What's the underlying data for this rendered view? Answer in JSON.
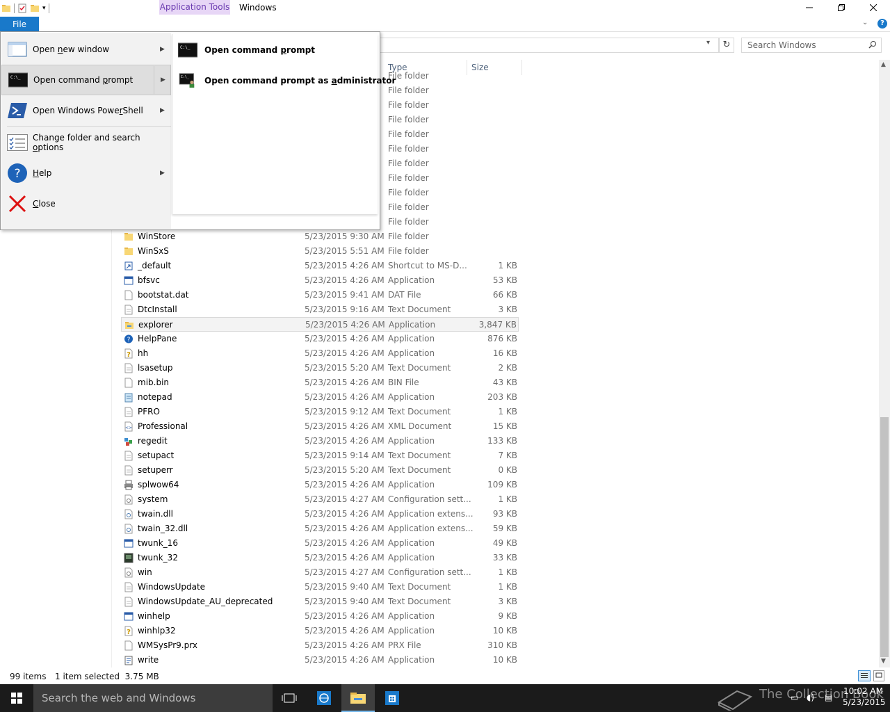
{
  "window": {
    "contextual_tab": "Application Tools",
    "title": "Windows"
  },
  "ribbon": {
    "file_tab": "File"
  },
  "search": {
    "placeholder": "Search Windows"
  },
  "columns": {
    "type": "Type",
    "size": "Size"
  },
  "files": [
    {
      "name": "",
      "date": "",
      "type": "File folder",
      "size": "",
      "icon": "folder-icon"
    },
    {
      "name": "",
      "date": "",
      "type": "File folder",
      "size": "",
      "icon": "folder-icon"
    },
    {
      "name": "",
      "date": "",
      "type": "File folder",
      "size": "",
      "icon": "folder-icon"
    },
    {
      "name": "",
      "date": "",
      "type": "File folder",
      "size": "",
      "icon": "folder-icon"
    },
    {
      "name": "",
      "date": "",
      "type": "File folder",
      "size": "",
      "icon": "folder-icon"
    },
    {
      "name": "",
      "date": "",
      "type": "File folder",
      "size": "",
      "icon": "folder-icon"
    },
    {
      "name": "",
      "date": "",
      "type": "File folder",
      "size": "",
      "icon": "folder-icon"
    },
    {
      "name": "",
      "date": "",
      "type": "File folder",
      "size": "",
      "icon": "folder-icon"
    },
    {
      "name": "",
      "date": "",
      "type": "File folder",
      "size": "",
      "icon": "folder-icon"
    },
    {
      "name": "",
      "date": "",
      "type": "File folder",
      "size": "",
      "icon": "folder-icon"
    },
    {
      "name": "",
      "date": "",
      "type": "File folder",
      "size": "",
      "icon": "folder-icon"
    },
    {
      "name": "WinStore",
      "date": "5/23/2015 9:30 AM",
      "type": "File folder",
      "size": "",
      "icon": "folder-icon"
    },
    {
      "name": "WinSxS",
      "date": "5/23/2015 5:51 AM",
      "type": "File folder",
      "size": "",
      "icon": "folder-icon"
    },
    {
      "name": "_default",
      "date": "5/23/2015 4:26 AM",
      "type": "Shortcut to MS-D...",
      "size": "1 KB",
      "icon": "shortcut-icon"
    },
    {
      "name": "bfsvc",
      "date": "5/23/2015 4:26 AM",
      "type": "Application",
      "size": "53 KB",
      "icon": "application-icon"
    },
    {
      "name": "bootstat.dat",
      "date": "5/23/2015 9:41 AM",
      "type": "DAT File",
      "size": "66 KB",
      "icon": "file-icon"
    },
    {
      "name": "DtcInstall",
      "date": "5/23/2015 9:16 AM",
      "type": "Text Document",
      "size": "3 KB",
      "icon": "text-file-icon"
    },
    {
      "name": "explorer",
      "date": "5/23/2015 4:26 AM",
      "type": "Application",
      "size": "3,847 KB",
      "icon": "explorer-icon",
      "selected": true
    },
    {
      "name": "HelpPane",
      "date": "5/23/2015 4:26 AM",
      "type": "Application",
      "size": "876 KB",
      "icon": "help-icon"
    },
    {
      "name": "hh",
      "date": "5/23/2015 4:26 AM",
      "type": "Application",
      "size": "16 KB",
      "icon": "help-file-icon"
    },
    {
      "name": "lsasetup",
      "date": "5/23/2015 5:20 AM",
      "type": "Text Document",
      "size": "2 KB",
      "icon": "text-file-icon"
    },
    {
      "name": "mib.bin",
      "date": "5/23/2015 4:26 AM",
      "type": "BIN File",
      "size": "43 KB",
      "icon": "file-icon"
    },
    {
      "name": "notepad",
      "date": "5/23/2015 4:26 AM",
      "type": "Application",
      "size": "203 KB",
      "icon": "notepad-icon"
    },
    {
      "name": "PFRO",
      "date": "5/23/2015 9:12 AM",
      "type": "Text Document",
      "size": "1 KB",
      "icon": "text-file-icon"
    },
    {
      "name": "Professional",
      "date": "5/23/2015 4:26 AM",
      "type": "XML Document",
      "size": "15 KB",
      "icon": "xml-file-icon"
    },
    {
      "name": "regedit",
      "date": "5/23/2015 4:26 AM",
      "type": "Application",
      "size": "133 KB",
      "icon": "regedit-icon"
    },
    {
      "name": "setupact",
      "date": "5/23/2015 9:14 AM",
      "type": "Text Document",
      "size": "7 KB",
      "icon": "text-file-icon"
    },
    {
      "name": "setuperr",
      "date": "5/23/2015 5:20 AM",
      "type": "Text Document",
      "size": "0 KB",
      "icon": "text-file-icon"
    },
    {
      "name": "splwow64",
      "date": "5/23/2015 4:26 AM",
      "type": "Application",
      "size": "109 KB",
      "icon": "printer-icon"
    },
    {
      "name": "system",
      "date": "5/23/2015 4:27 AM",
      "type": "Configuration sett...",
      "size": "1 KB",
      "icon": "config-file-icon"
    },
    {
      "name": "twain.dll",
      "date": "5/23/2015 4:26 AM",
      "type": "Application extens...",
      "size": "93 KB",
      "icon": "dll-icon"
    },
    {
      "name": "twain_32.dll",
      "date": "5/23/2015 4:26 AM",
      "type": "Application extens...",
      "size": "59 KB",
      "icon": "dll-icon"
    },
    {
      "name": "twunk_16",
      "date": "5/23/2015 4:26 AM",
      "type": "Application",
      "size": "49 KB",
      "icon": "application-icon"
    },
    {
      "name": "twunk_32",
      "date": "5/23/2015 4:26 AM",
      "type": "Application",
      "size": "33 KB",
      "icon": "scanner-icon"
    },
    {
      "name": "win",
      "date": "5/23/2015 4:27 AM",
      "type": "Configuration sett...",
      "size": "1 KB",
      "icon": "config-file-icon"
    },
    {
      "name": "WindowsUpdate",
      "date": "5/23/2015 9:40 AM",
      "type": "Text Document",
      "size": "1 KB",
      "icon": "text-file-icon"
    },
    {
      "name": "WindowsUpdate_AU_deprecated",
      "date": "5/23/2015 9:40 AM",
      "type": "Text Document",
      "size": "3 KB",
      "icon": "text-file-icon"
    },
    {
      "name": "winhelp",
      "date": "5/23/2015 4:26 AM",
      "type": "Application",
      "size": "9 KB",
      "icon": "application-icon"
    },
    {
      "name": "winhlp32",
      "date": "5/23/2015 4:26 AM",
      "type": "Application",
      "size": "10 KB",
      "icon": "help-file-icon"
    },
    {
      "name": "WMSysPr9.prx",
      "date": "5/23/2015 4:26 AM",
      "type": "PRX File",
      "size": "310 KB",
      "icon": "file-icon"
    },
    {
      "name": "write",
      "date": "5/23/2015 4:26 AM",
      "type": "Application",
      "size": "10 KB",
      "icon": "wordpad-icon"
    }
  ],
  "first_row_partial_type": "File folder",
  "status": {
    "item_count": "99 items",
    "selection": "1 item selected  3.75 MB"
  },
  "file_menu": {
    "items": [
      {
        "label_pre": "Open ",
        "label_u": "n",
        "label_post": "ew window",
        "icon": "new-window-icon",
        "has_arrow": true
      },
      {
        "label_pre": "Open command ",
        "label_u": "p",
        "label_post": "rompt",
        "icon": "command-prompt-icon",
        "has_arrow": true,
        "highlighted": true
      },
      {
        "label_pre": "Open Windows Powe",
        "label_u": "r",
        "label_post": "Shell",
        "icon": "powershell-icon",
        "has_arrow": true
      },
      {
        "label_pre": "Change folder and search ",
        "label_u": "o",
        "label_post": "ptions",
        "icon": "folder-options-icon",
        "has_arrow": false
      },
      {
        "label_pre": "",
        "label_u": "H",
        "label_post": "elp",
        "icon": "help-icon",
        "has_arrow": true
      },
      {
        "label_pre": "",
        "label_u": "C",
        "label_post": "lose",
        "icon": "close-icon",
        "has_arrow": false
      }
    ],
    "submenu": [
      {
        "label_pre": "Open command ",
        "label_u": "p",
        "label_post": "rompt",
        "icon": "command-prompt-icon"
      },
      {
        "label_pre": "Open command prompt as ",
        "label_u": "a",
        "label_post": "dministrator",
        "icon": "admin-command-prompt-icon"
      }
    ]
  },
  "taskbar": {
    "search_placeholder": "Search the web and Windows",
    "time": "10:02 AM",
    "date": "5/23/2015",
    "watermark": "The Collection Book"
  },
  "colors": {
    "accent": "#1979ca",
    "contextual_tab_bg": "#e7d6f6",
    "taskbar": "#1b1b1b"
  }
}
